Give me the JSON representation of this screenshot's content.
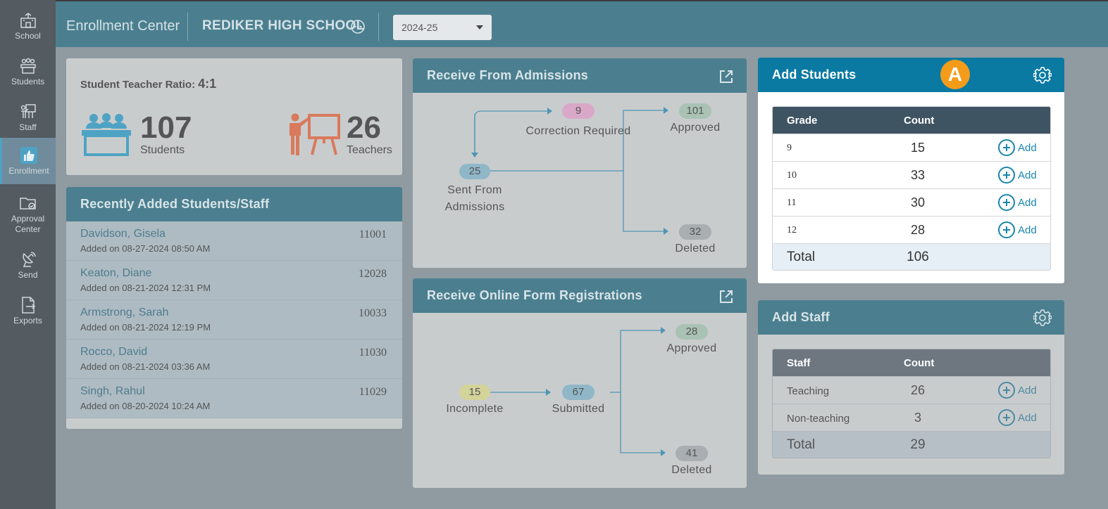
{
  "sidebar": {
    "items": [
      {
        "label": "School",
        "icon": "school-icon"
      },
      {
        "label": "Students",
        "icon": "students-icon"
      },
      {
        "label": "Staff",
        "icon": "staff-icon"
      },
      {
        "label": "Enrollment",
        "icon": "thumbs-up-icon",
        "active": true
      },
      {
        "label": "Approval Center",
        "icon": "folder-check-icon"
      },
      {
        "label": "Send",
        "icon": "antenna-icon"
      },
      {
        "label": "Exports",
        "icon": "export-file-icon"
      }
    ]
  },
  "header": {
    "app_title": "Enrollment Center",
    "school_name": "REDIKER HIGH SCHOOL",
    "year": "2024-25"
  },
  "ratio_card": {
    "label": "Student Teacher Ratio:",
    "value": "4:1",
    "students_count": "107",
    "students_label": "Students",
    "teachers_count": "26",
    "teachers_label": "Teachers"
  },
  "recent": {
    "title": "Recently Added Students/Staff",
    "rows": [
      {
        "name": "Davidson, Gisela",
        "id": "11001",
        "date": "Added on 08-27-2024 08:50 AM"
      },
      {
        "name": "Keaton, Diane",
        "id": "12028",
        "date": "Added on 08-21-2024 12:31 PM"
      },
      {
        "name": "Armstrong, Sarah",
        "id": "10033",
        "date": "Added on 08-21-2024 12:19 PM"
      },
      {
        "name": "Rocco, David",
        "id": "11030",
        "date": "Added on 08-21-2024 03:36 AM"
      },
      {
        "name": "Singh, Rahul",
        "id": "11029",
        "date": "Added on 08-20-2024 10:24 AM"
      }
    ]
  },
  "admissions": {
    "title": "Receive From Admissions",
    "sent": {
      "count": "25",
      "label_line1": "Sent From",
      "label_line2": "Admissions"
    },
    "correction": {
      "count": "9",
      "label": "Correction Required"
    },
    "approved": {
      "count": "101",
      "label": "Approved"
    },
    "deleted": {
      "count": "32",
      "label": "Deleted"
    }
  },
  "online_forms": {
    "title": "Receive Online Form Registrations",
    "incomplete": {
      "count": "15",
      "label": "Incomplete"
    },
    "submitted": {
      "count": "67",
      "label": "Submitted"
    },
    "approved": {
      "count": "28",
      "label": "Approved"
    },
    "deleted": {
      "count": "41",
      "label": "Deleted"
    }
  },
  "add_students": {
    "title": "Add Students",
    "marker": "A",
    "col_grade": "Grade",
    "col_count": "Count",
    "add_label": "Add",
    "rows": [
      {
        "grade": "9",
        "count": "15"
      },
      {
        "grade": "10",
        "count": "33"
      },
      {
        "grade": "11",
        "count": "30"
      },
      {
        "grade": "12",
        "count": "28"
      }
    ],
    "total_label": "Total",
    "total": "106"
  },
  "add_staff": {
    "title": "Add Staff",
    "col_staff": "Staff",
    "col_count": "Count",
    "add_label": "Add",
    "rows": [
      {
        "type": "Teaching",
        "count": "26"
      },
      {
        "type": "Non-teaching",
        "count": "3"
      }
    ],
    "total_label": "Total",
    "total": "29"
  },
  "colors": {
    "accent": "#0a7aa3",
    "header_teal": "#4b7f8f",
    "marker_orange": "#f49c1a",
    "pill_pink": "#d9a8c8",
    "pill_green": "#a9c2b4",
    "pill_gray": "#a8aeb1",
    "pill_blue": "#8fb7c8",
    "pill_yellow": "#d4d39a"
  }
}
